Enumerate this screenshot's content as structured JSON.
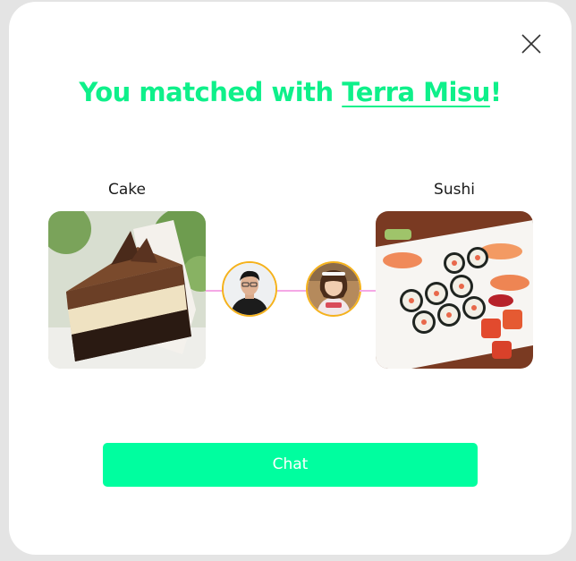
{
  "dialog": {
    "title_prefix": "You matched with ",
    "match_name": "Terra Misu",
    "title_suffix": "!",
    "close_icon": "close-icon"
  },
  "left_card": {
    "label": "Cake",
    "image": "chocolate-cake-slice"
  },
  "right_card": {
    "label": "Sushi",
    "image": "sushi-platter"
  },
  "avatars": {
    "left": "user-avatar-man",
    "right": "user-avatar-woman"
  },
  "chat_button": {
    "label": "Chat"
  },
  "colors": {
    "accent": "#0ef08a",
    "button": "#00fe9f",
    "avatar_border": "#f5b21c",
    "connector": "#f5a8e6"
  }
}
